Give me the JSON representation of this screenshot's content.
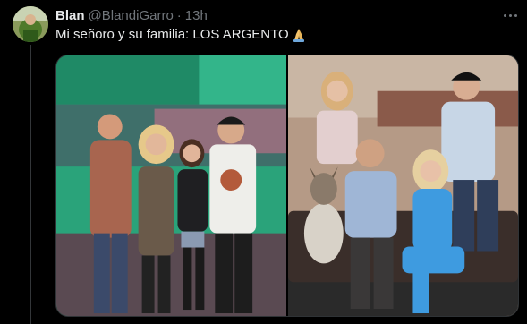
{
  "tweet": {
    "author_name": "Blan",
    "handle": "@BlandiGarro",
    "separator": "·",
    "time": "13h",
    "text": "Mi señoro y su familia: LOS ARGENTO",
    "text_emoji": "folded-hands"
  },
  "media": {
    "images": [
      {
        "icon": "family-photo-studio"
      },
      {
        "icon": "tv-cast-photo"
      }
    ]
  },
  "colors": {
    "background": "#000000",
    "primary_text": "#e7e9ea",
    "secondary_text": "#71767b",
    "divider": "#2f3336"
  }
}
